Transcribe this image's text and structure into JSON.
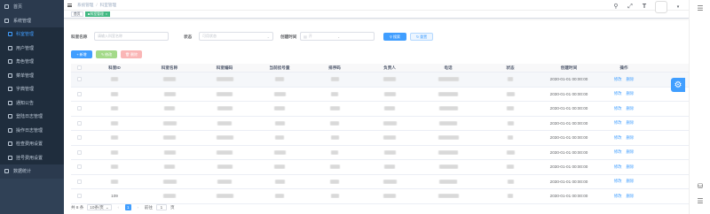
{
  "sidebar": {
    "items": [
      {
        "label": "首页",
        "icon": "home-icon",
        "level": "top"
      },
      {
        "label": "系统管理",
        "icon": "system-icon",
        "level": "top"
      },
      {
        "label": "科室管理",
        "icon": "tree-icon",
        "level": "sub",
        "active": true
      },
      {
        "label": "用户管理",
        "icon": "user-icon",
        "level": "sub"
      },
      {
        "label": "角色管理",
        "icon": "peoples-icon",
        "level": "sub"
      },
      {
        "label": "菜单管理",
        "icon": "menu-icon",
        "level": "sub"
      },
      {
        "label": "字典管理",
        "icon": "dict-icon",
        "level": "sub"
      },
      {
        "label": "通知公告",
        "icon": "message-icon",
        "level": "sub"
      },
      {
        "label": "登陆日志管理",
        "icon": "log-icon",
        "level": "sub"
      },
      {
        "label": "操作日志管理",
        "icon": "form-icon",
        "level": "sub"
      },
      {
        "label": "检查费用设置",
        "icon": "money-icon",
        "level": "sub"
      },
      {
        "label": "挂号费用设置",
        "icon": "money-icon",
        "level": "sub"
      },
      {
        "label": "数据统计",
        "icon": "chart-icon",
        "level": "top"
      }
    ]
  },
  "breadcrumb": {
    "items": [
      "系统管理",
      "科室管理"
    ],
    "sep": "/"
  },
  "navbar": {
    "icons": [
      "search-icon",
      "fullscreen-icon",
      "font-size-icon",
      "avatar"
    ]
  },
  "tags": [
    {
      "label": "首页",
      "active": false
    },
    {
      "label": "科室管理",
      "active": true,
      "close": "×"
    }
  ],
  "search": {
    "name_label": "科室名称",
    "name_placeholder": "请输入科室名称",
    "status_label": "状态",
    "status_placeholder": "可用状态",
    "date_label": "创建时间",
    "date_start_placeholder": "开",
    "date_sep": "-",
    "search_btn": "搜索",
    "reset_btn": "重置"
  },
  "toolbar": {
    "add": "新增",
    "edit": "修改",
    "delete": "删除"
  },
  "table": {
    "columns": [
      "科室ID",
      "科室名称",
      "科室编码",
      "当前挂号量",
      "排序码",
      "负责人",
      "电话",
      "状态",
      "创建时间",
      "操作"
    ],
    "rows": [
      {
        "id": "",
        "created": "2030-01-01 00:00:00"
      },
      {
        "id": "",
        "created": "2030-01-01 00:00:00"
      },
      {
        "id": "",
        "created": "2030-01-01 00:00:00"
      },
      {
        "id": "",
        "created": "2030-01-01 00:00:00"
      },
      {
        "id": "",
        "created": "2030-01-01 00:00:00"
      },
      {
        "id": "",
        "created": "2030-01-01 00:00:00"
      },
      {
        "id": "",
        "created": "2030-01-01 00:00:00"
      },
      {
        "id": "",
        "created": "2030-01-01 00:00:00"
      },
      {
        "id": "109",
        "created": "2030-01-01 00:00:00"
      }
    ],
    "op_edit": "修改",
    "op_delete": "删除"
  },
  "pagination": {
    "total": "共 8 条",
    "page_size": "10条/页",
    "current": "1",
    "goto_label": "前往",
    "goto_value": "1",
    "page_unit": "页"
  },
  "colors": {
    "primary": "#409eff",
    "sidebar": "#304156",
    "active_tag": "#42b983"
  }
}
